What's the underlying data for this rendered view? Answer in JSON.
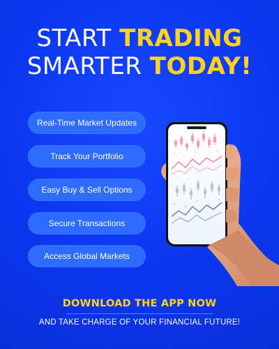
{
  "headline": {
    "line1_part1": "START",
    "line1_part2": "TRADING",
    "line2_part1": "SMARTER",
    "line2_part2": "TODAY!"
  },
  "features": [
    {
      "label": "Real-Time Market Updates"
    },
    {
      "label": "Track Your Portfolio"
    },
    {
      "label": "Easy Buy & Sell Options"
    },
    {
      "label": "Secure Transactions"
    },
    {
      "label": "Access Global Markets"
    }
  ],
  "cta": {
    "title": "DOWNLOAD THE APP NOW",
    "subtitle": "AND TAKE CHARGE OF YOUR FINANCIAL FUTURE!"
  },
  "colors": {
    "background": "#0c36f0",
    "accent": "#ffd21f",
    "pill": "#2e6cff",
    "text": "#ffffff"
  },
  "icons": {
    "phone": "smartphone-trading-chart",
    "hand": "hand-holding-phone"
  }
}
